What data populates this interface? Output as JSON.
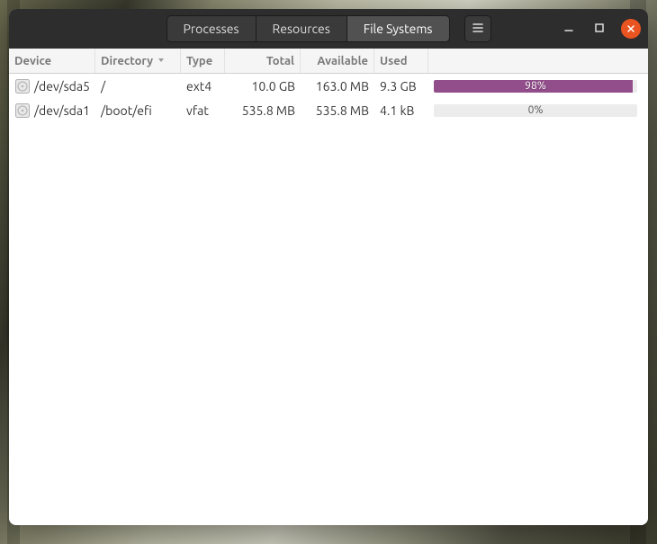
{
  "tabs": [
    {
      "label": "Processes",
      "active": false
    },
    {
      "label": "Resources",
      "active": false
    },
    {
      "label": "File Systems",
      "active": true
    }
  ],
  "columns": {
    "device": "Device",
    "directory": "Directory",
    "type": "Type",
    "total": "Total",
    "available": "Available",
    "used": "Used"
  },
  "sortColumn": "directory",
  "filesystems": [
    {
      "device": "/dev/sda5",
      "directory": "/",
      "type": "ext4",
      "total": "10.0 GB",
      "available": "163.0 MB",
      "used": "9.3 GB",
      "usedPercent": 98,
      "usedLabel": "98%"
    },
    {
      "device": "/dev/sda1",
      "directory": "/boot/efi",
      "type": "vfat",
      "total": "535.8 MB",
      "available": "535.8 MB",
      "used": "4.1 kB",
      "usedPercent": 0,
      "usedLabel": "0%"
    }
  ],
  "colors": {
    "accent": "#924d8b"
  }
}
